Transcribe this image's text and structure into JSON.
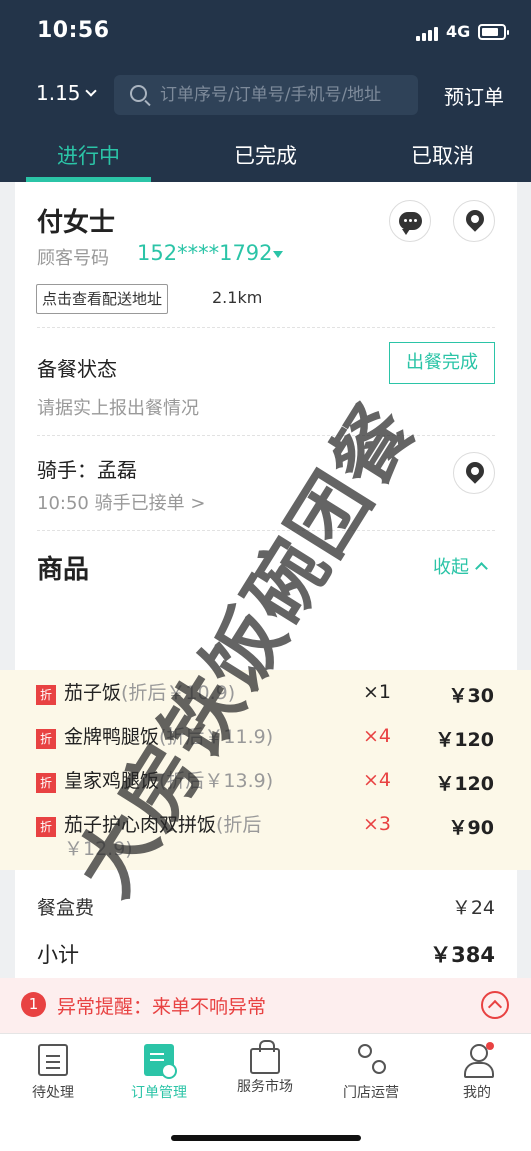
{
  "status_bar": {
    "time": "10:56",
    "network": "4G"
  },
  "header": {
    "date": "1.15",
    "search_placeholder": "订单序号/订单号/手机号/地址",
    "reserve_label": "预订单",
    "tabs": [
      {
        "label": "进行中",
        "active": true
      },
      {
        "label": "已完成",
        "active": false
      },
      {
        "label": "已取消",
        "active": false
      }
    ]
  },
  "order": {
    "customer_name": "付女士",
    "phone_label": "顾客号码",
    "phone": "152****1792",
    "address_button": "点击查看配送地址",
    "distance": "2.1km",
    "prep_title": "备餐状态",
    "prep_hint": "请据实上报出餐情况",
    "prep_button": "出餐完成",
    "rider_title": "骑手：孟磊",
    "rider_status": "10:50  骑手已接单 >",
    "goods_title": "商品",
    "collapse_label": "收起",
    "items": [
      {
        "badge": "折",
        "name": "茄子饭",
        "after": "(折后￥10.9)",
        "qty": "×1",
        "qty_highlight": false,
        "price": "￥30"
      },
      {
        "badge": "折",
        "name": "金牌鸭腿饭",
        "after": "(折后￥11.9)",
        "qty": "×4",
        "qty_highlight": true,
        "price": "￥120"
      },
      {
        "badge": "折",
        "name": "皇家鸡腿饭",
        "after": "(折后￥13.9)",
        "qty": "×4",
        "qty_highlight": true,
        "price": "￥120"
      },
      {
        "badge": "折",
        "name": "茄子护心肉双拼饭",
        "after": "(折后￥12.9)",
        "qty": "×3",
        "qty_highlight": true,
        "price": "￥90"
      }
    ],
    "box_fee_label": "餐盒费",
    "box_fee": "￥24",
    "subtotal_label": "小计",
    "subtotal": "￥384",
    "watermark": "大房铁饭碗团餐"
  },
  "alert": {
    "count": "1",
    "text": "异常提醒：来单不响异常"
  },
  "bottom_nav": [
    {
      "label": "待处理",
      "icon": "clipboard-icon",
      "active": false
    },
    {
      "label": "订单管理",
      "icon": "order-icon",
      "active": true
    },
    {
      "label": "服务市场",
      "icon": "shopping-bag-icon",
      "active": false
    },
    {
      "label": "门店运营",
      "icon": "flow-icon",
      "active": false
    },
    {
      "label": "我的",
      "icon": "user-icon",
      "active": false,
      "dot": true
    }
  ],
  "colors": {
    "accent": "#2bc4a7",
    "header_bg": "#233449",
    "danger": "#e84242",
    "highlight_bg": "#fcf8e8"
  }
}
